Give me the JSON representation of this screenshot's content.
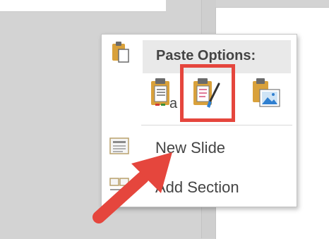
{
  "context_menu": {
    "paste_options_label": "Paste Options:",
    "paste_buttons": [
      {
        "icon": "paste-keep-text-only-icon"
      },
      {
        "icon": "paste-use-destination-theme-icon"
      },
      {
        "icon": "paste-picture-icon"
      }
    ],
    "items": [
      {
        "label": "New Slide",
        "icon": "new-slide-icon"
      },
      {
        "label": "Add Section",
        "icon": "add-section-icon"
      }
    ]
  },
  "annotation": {
    "highlight_color": "#e5463d",
    "arrow_color": "#e5463d"
  }
}
